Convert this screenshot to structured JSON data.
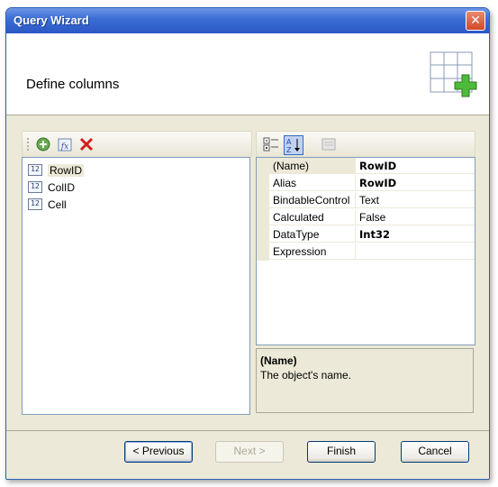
{
  "window": {
    "title": "Query Wizard",
    "close_label": "✕"
  },
  "header": {
    "title": "Define columns"
  },
  "columns_list": [
    {
      "type_badge": "12",
      "label": "RowID",
      "selected": true
    },
    {
      "type_badge": "12",
      "label": "ColID",
      "selected": false
    },
    {
      "type_badge": "12",
      "label": "Cell",
      "selected": false
    }
  ],
  "properties": [
    {
      "name": "(Name)",
      "value": "RowID",
      "bold": true
    },
    {
      "name": "Alias",
      "value": "RowID",
      "bold": true
    },
    {
      "name": "BindableControl",
      "value": "Text",
      "bold": false
    },
    {
      "name": "Calculated",
      "value": "False",
      "bold": false
    },
    {
      "name": "DataType",
      "value": "Int32",
      "bold": true
    },
    {
      "name": "Expression",
      "value": "",
      "bold": false
    }
  ],
  "help": {
    "title": "(Name)",
    "text": "The object's name."
  },
  "buttons": {
    "previous": "< Previous",
    "next": "Next >",
    "finish": "Finish",
    "cancel": "Cancel"
  }
}
